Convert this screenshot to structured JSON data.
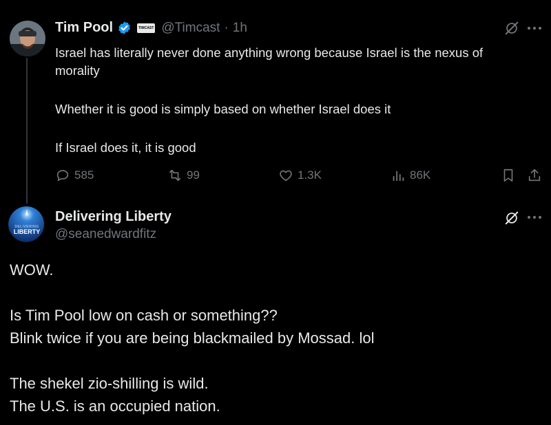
{
  "tweet1": {
    "author": {
      "name": "Tim Pool",
      "badge": "TIMCAST",
      "handle": "@Timcast",
      "separator": "·",
      "time": "1h"
    },
    "lines": [
      "Israel has literally never done anything wrong because Israel is the nexus of",
      "morality",
      "Whether it is good is simply based on whether Israel does it",
      "If Israel does it, it is good"
    ],
    "actions": {
      "replies": "585",
      "reposts": "99",
      "likes": "1.3K",
      "views": "86K"
    }
  },
  "tweet2": {
    "author": {
      "name": "Delivering Liberty",
      "handle": "@seanedwardfitz",
      "avatar_top": "DELIVERING",
      "avatar_bottom": "LIBERTY"
    },
    "lines": [
      "WOW.",
      "Is Tim Pool low on cash or something??",
      "Blink twice if you are being blackmailed by Mossad. lol",
      "The shekel zio-shilling is wild.",
      "The U.S. is an occupied nation."
    ]
  },
  "colors": {
    "background": "#000000",
    "text": "#e7e9ea",
    "muted": "#71767b",
    "verified": "#1d9bf0"
  }
}
